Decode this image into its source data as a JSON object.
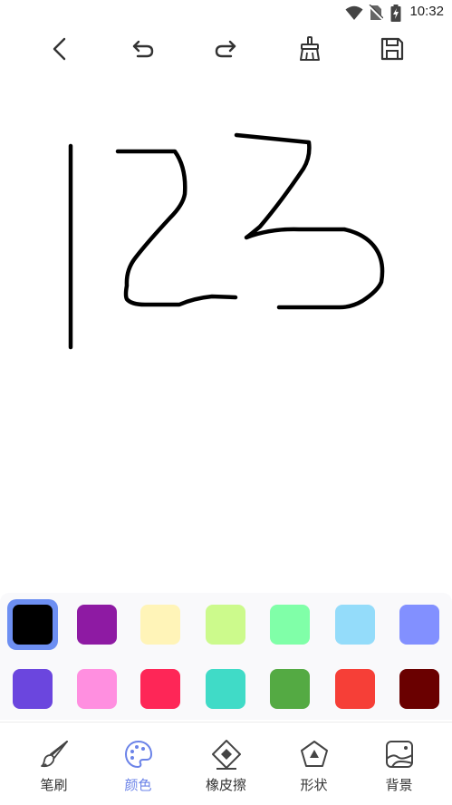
{
  "status_bar": {
    "time": "10:32",
    "icons": [
      "wifi-icon",
      "no-sim-icon",
      "battery-charging-icon"
    ]
  },
  "toolbar": {
    "buttons": [
      "back-icon",
      "undo-icon",
      "redo-icon",
      "clear-canvas-icon",
      "save-icon"
    ]
  },
  "canvas": {
    "stroke_color": "#000000",
    "content": "handwritten 123"
  },
  "palette": {
    "selected_index": 0,
    "colors": [
      "#000000",
      "#8e1aa3",
      "#fff4b8",
      "#ccfa8c",
      "#80ffa8",
      "#94dcfa",
      "#8290ff",
      "#6b46de",
      "#ff8fe0",
      "#fe2657",
      "#40dbc7",
      "#54aa43",
      "#f63f37",
      "#6a0000"
    ]
  },
  "bottom_nav": {
    "active_index": 1,
    "active_color": "#6b83e8",
    "items": [
      {
        "label": "笔刷",
        "icon": "brush-icon"
      },
      {
        "label": "颜色",
        "icon": "palette-icon"
      },
      {
        "label": "橡皮擦",
        "icon": "eraser-icon"
      },
      {
        "label": "形状",
        "icon": "shape-icon"
      },
      {
        "label": "背景",
        "icon": "background-image-icon"
      }
    ]
  }
}
